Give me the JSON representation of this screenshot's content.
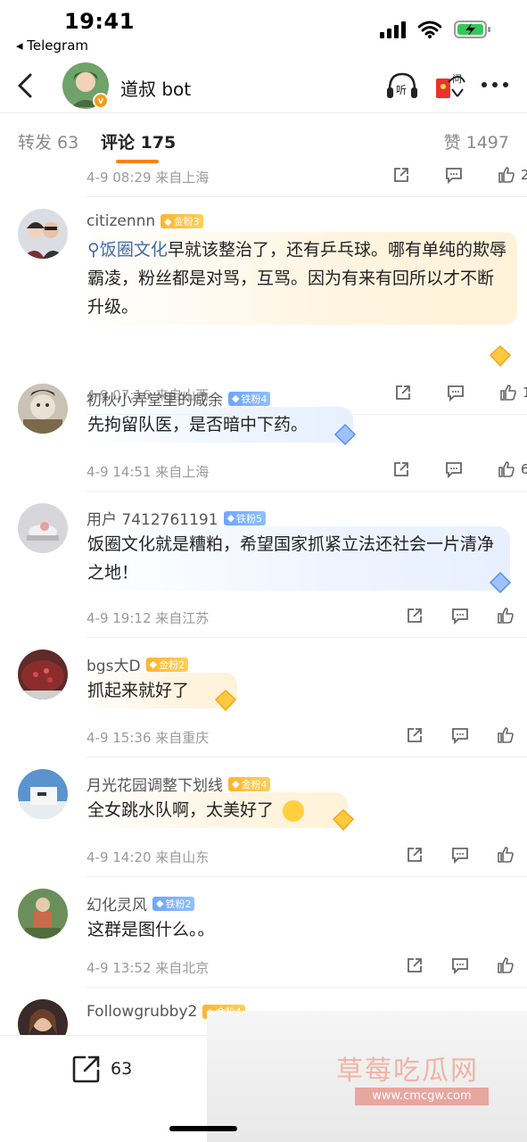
{
  "status_bar": {
    "time": "19:41",
    "back_app": "◂ Telegram"
  },
  "nav": {
    "title": "道叔 bot",
    "listen_label": "听",
    "ask_label": "问"
  },
  "tabs": {
    "repost": "转发 63",
    "comment": "评论 175",
    "like": "赞 1497"
  },
  "top_meta": {
    "time_loc": "4-9 08:29  来自上海",
    "like_count": "2"
  },
  "comments": [
    {
      "name": "citizennn",
      "badge": "金粉3",
      "topic": "饭圈文化",
      "text_after_topic": "早就该整治了，还有乒乓球。哪有单纯的欺辱霸凌，粉丝都是对骂，互骂。因为有来有回所以才不断升级。",
      "meta": "4-9 07:16  来自山西",
      "likes": "1"
    },
    {
      "name": "初秋小弄堂里的咸余",
      "badge": "铁粉4",
      "text": "先拘留队医，是否暗中下药。",
      "meta": "4-9 14:51  来自上海",
      "likes": "6"
    },
    {
      "name": "用户 7412761191",
      "badge": "铁粉5",
      "text": "饭圈文化就是糟粕，希望国家抓紧立法还社会一片清净之地！",
      "meta": "4-9 19:12  来自江苏",
      "likes": ""
    },
    {
      "name": "bgs大D",
      "badge": "金粉2",
      "text": "抓起来就好了",
      "meta": "4-9 15:36  来自重庆",
      "likes": ""
    },
    {
      "name": "月光花园调整下划线",
      "badge": "金粉4",
      "text": "全女跳水队啊，太美好了",
      "meta": "4-9 14:20  来自山东",
      "likes": ""
    },
    {
      "name": "幻化灵风",
      "badge": "铁粉2",
      "text": "这群是图什么。。",
      "meta": "4-9 13:52  来自北京",
      "likes": ""
    },
    {
      "name": "Followgrubby2",
      "badge": "金粉4"
    }
  ],
  "bottom": {
    "share_count": "63"
  },
  "watermark": {
    "text": "草莓吃瓜网",
    "url": "www.cmcgw.com"
  },
  "colors": {
    "accent": "#ff8200",
    "topic": "#3d6ba8",
    "gold_badge": "#ffb52e",
    "iron_badge": "#6ea6ff"
  }
}
